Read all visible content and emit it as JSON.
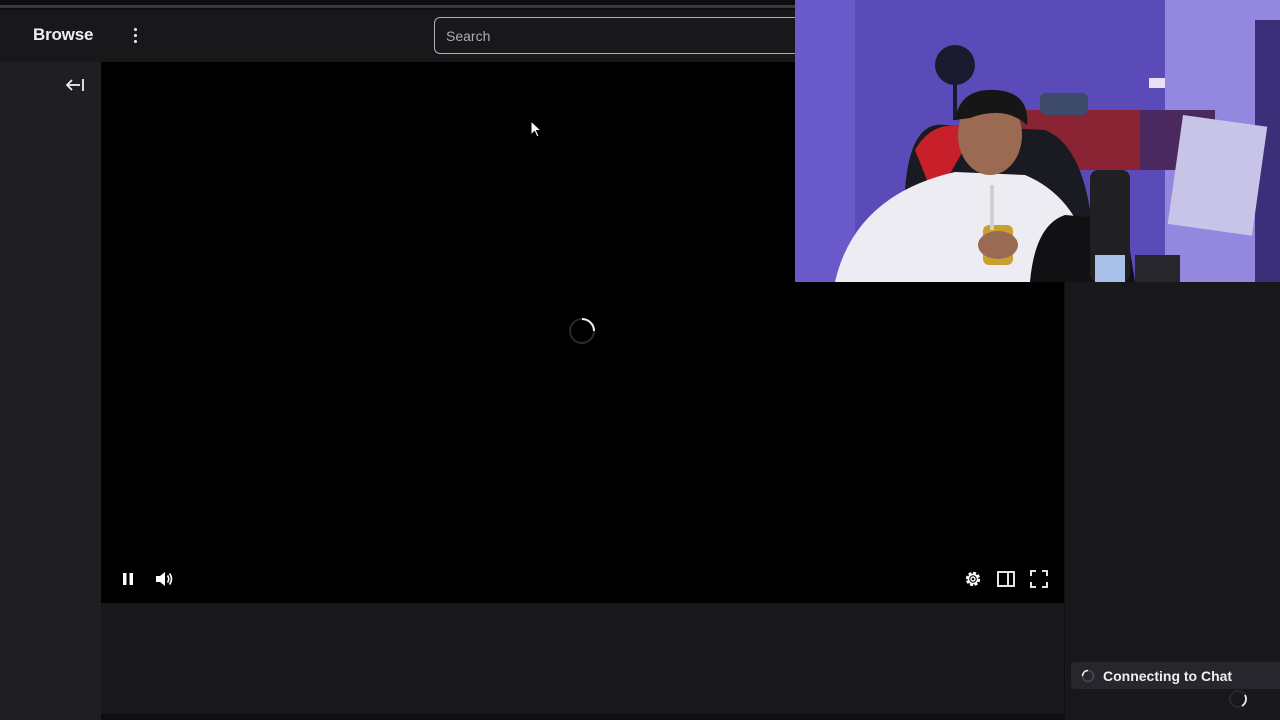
{
  "header": {
    "browse_label": "Browse",
    "more_icon": "kebab-vertical-icon",
    "search_placeholder": "Search"
  },
  "sidebar": {
    "collapse_icon": "arrow-left-bar-icon"
  },
  "player": {
    "state": "loading",
    "controls_left": [
      "pause-icon",
      "volume-icon"
    ],
    "controls_right": [
      "gear-icon",
      "theatre-mode-icon",
      "fullscreen-icon"
    ]
  },
  "chat": {
    "status_text": "Connecting to Chat"
  },
  "colors": {
    "background": "#0e0e10",
    "header": "#18181b",
    "sidebar": "#1f1f23",
    "player": "#000000",
    "text": "#efeff1",
    "muted_text": "#adadb8"
  }
}
